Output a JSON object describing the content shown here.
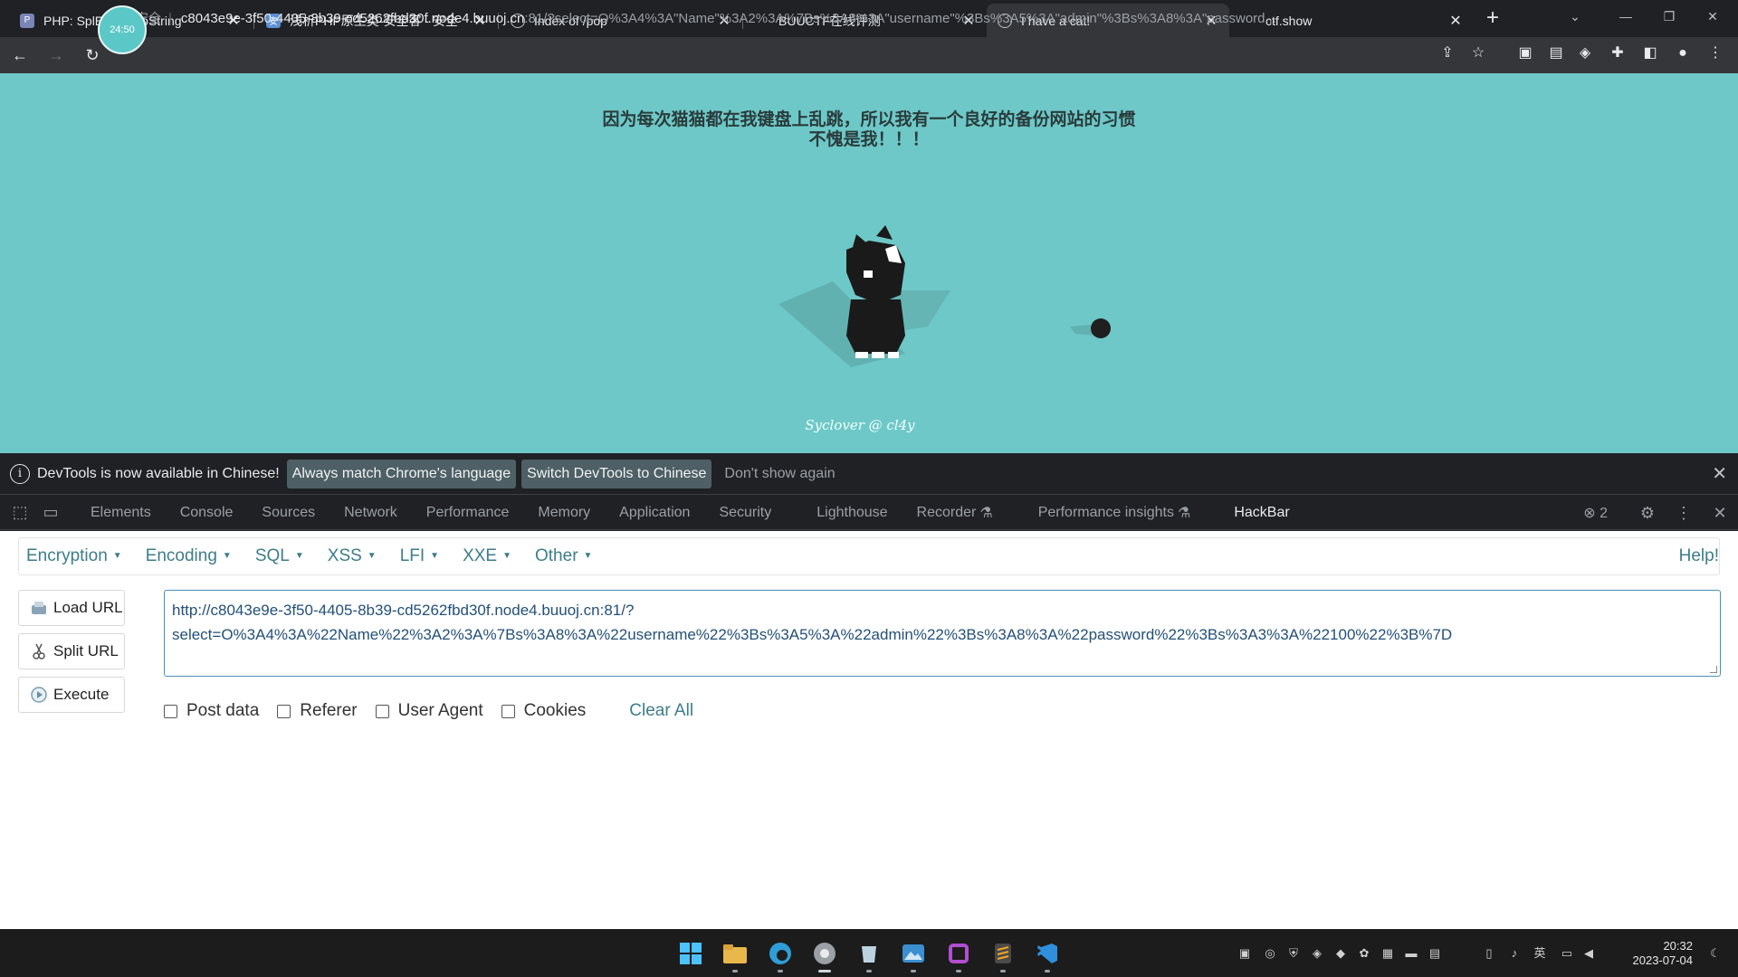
{
  "browser": {
    "tabs": [
      {
        "title": "PHP: SplE      ct::__toString",
        "favicon": "php-icon",
        "active": false
      },
      {
        "title": "浅析PHP原生类-安全客 - 安全",
        "favicon": "anquanke-icon",
        "active": false
      },
      {
        "title": "Index of /pop",
        "favicon": "globe-icon",
        "active": false
      },
      {
        "title": "BUUCTF在线评测",
        "favicon": "buuctf-icon",
        "active": false
      },
      {
        "title": "I have a cat!",
        "favicon": "globe-icon",
        "active": true
      },
      {
        "title": "ctf.show",
        "favicon": "ctfshow-icon",
        "active": false
      }
    ],
    "timer_badge": "24:50",
    "address": {
      "security_label": "不安全",
      "host": "c8043e9e-3f50-4405-8b39-cd5262fbd30f.node4.buuoj.cn",
      "rest": ":81/?select=O%3A4%3A\"Name\"%3A2%3A%7Bs%3A8%3A\"username\"%3Bs%3A5%3A\"admin\"%3Bs%3A8%3A\"password..."
    }
  },
  "page": {
    "heading_line1": "因为每次猫猫都在我键盘上乱跳，所以我有一个良好的备份网站的习惯",
    "heading_line2": "不愧是我！！！",
    "footer": "Syclover @ cl4y",
    "background_color": "#6ec8c8"
  },
  "devtools": {
    "infobar": {
      "message": "DevTools is now available in Chinese!",
      "btn_match": "Always match Chrome's language",
      "btn_switch": "Switch DevTools to Chinese",
      "dont_show": "Don't show again"
    },
    "tabs": [
      "Elements",
      "Console",
      "Sources",
      "Network",
      "Performance",
      "Memory",
      "Application",
      "Security",
      "Lighthouse",
      "Recorder",
      "Performance insights",
      "HackBar"
    ],
    "active_tab": "HackBar",
    "error_count": "2"
  },
  "hackbar": {
    "menu": [
      "Encryption",
      "Encoding",
      "SQL",
      "XSS",
      "LFI",
      "XXE",
      "Other"
    ],
    "help": "Help!",
    "buttons": {
      "load": "Load URL",
      "split": "Split URL",
      "execute": "Execute"
    },
    "url_line1": "http://c8043e9e-3f50-4405-8b39-cd5262fbd30f.node4.buuoj.cn:81/?",
    "url_line2": "select=O%3A4%3A%22Name%22%3A2%3A%7Bs%3A8%3A%22username%22%3Bs%3A5%3A%22admin%22%3Bs%3A8%3A%22password%22%3Bs%3A3%3A%22100%22%3B%7D",
    "options": {
      "post_data": "Post data",
      "referer": "Referer",
      "user_agent": "User Agent",
      "cookies": "Cookies"
    },
    "clear_all": "Clear All",
    "accent_color": "#3d7d8a"
  },
  "taskbar": {
    "time": "20:32",
    "date": "2023-07-04",
    "ime": "英"
  }
}
